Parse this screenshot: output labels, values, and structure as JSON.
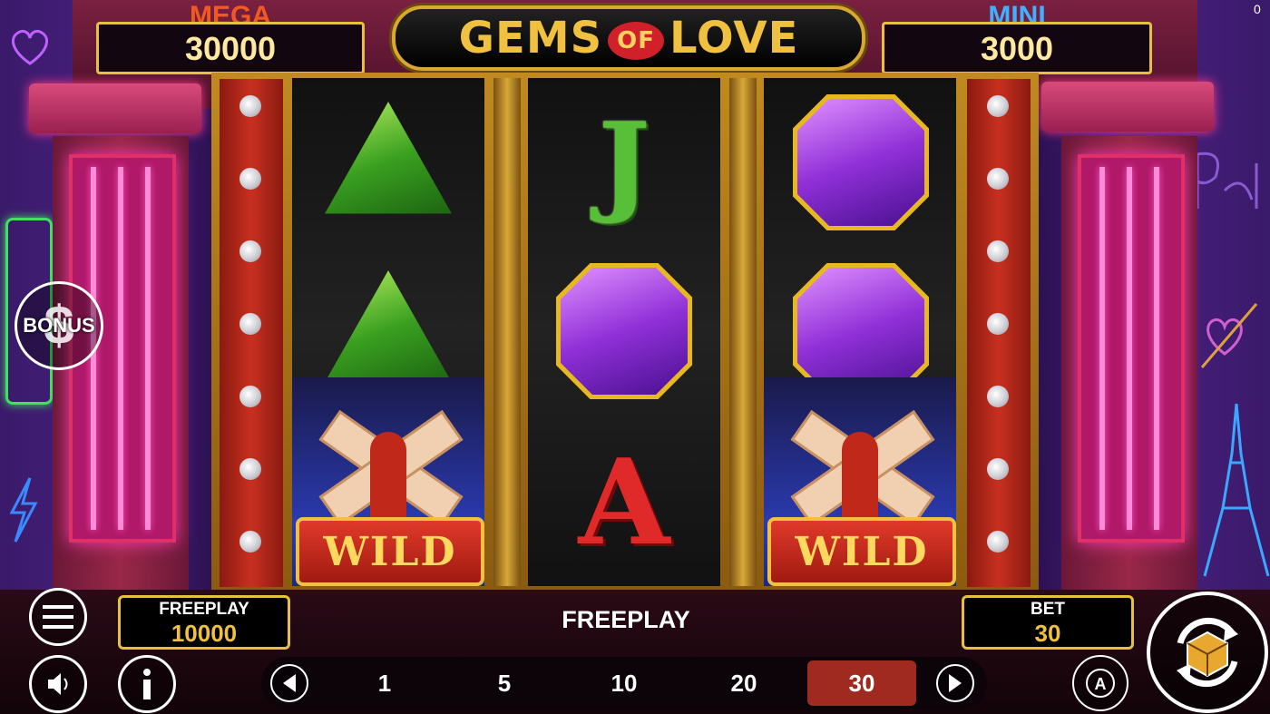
{
  "jackpots": {
    "mega": {
      "label": "MEGA",
      "value": "30000"
    },
    "mini": {
      "label": "MINI",
      "value": "3000"
    }
  },
  "logo": {
    "left": "GEMS",
    "middle": "OF",
    "right": "LOVE"
  },
  "corner_counter": "0",
  "bonus_button": {
    "label": "BONUS",
    "symbol": "$"
  },
  "reels": [
    {
      "symbols": [
        "green-gem",
        "green-gem",
        "wild"
      ]
    },
    {
      "symbols": [
        "J",
        "purple-gem",
        "A"
      ]
    },
    {
      "symbols": [
        "purple-gem",
        "purple-gem",
        "wild"
      ]
    }
  ],
  "symbol_text": {
    "J": "J",
    "A": "A",
    "wild": "WILD"
  },
  "balance": {
    "label": "FREEPLAY",
    "value": "10000"
  },
  "status_message": "FREEPLAY",
  "bet": {
    "label": "BET",
    "value": "30"
  },
  "bet_options": [
    "1",
    "5",
    "10",
    "20",
    "30"
  ],
  "selected_bet": "30",
  "icons": [
    "menu-icon",
    "sound-icon",
    "info-icon",
    "arrow-left-icon",
    "arrow-right-icon",
    "autoplay-icon",
    "spin-icon"
  ],
  "colors": {
    "gold": "#e8c040",
    "selected_bet": "#a02a20",
    "mega": "#f05a20",
    "mini": "#40b0ff"
  }
}
